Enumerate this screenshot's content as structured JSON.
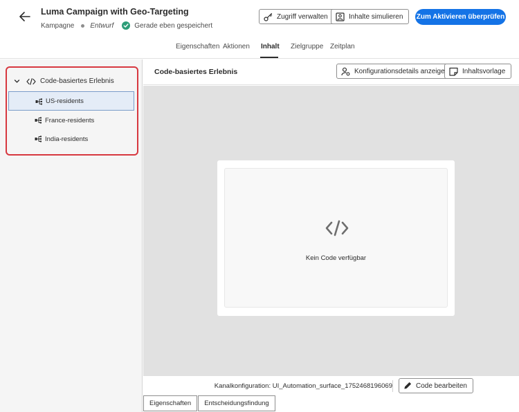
{
  "header": {
    "title": "Luma Campaign with Geo-Targeting",
    "type": "Kampagne",
    "status": "Entwurf",
    "save_status": "Gerade eben gespeichert",
    "manage_access": "Zugriff verwalten",
    "simulate_content": "Inhalte simulieren",
    "review_activate": "Zum Aktivieren überprüfen"
  },
  "tabs": [
    "Eigenschaften",
    "Aktionen",
    "Inhalt",
    "Zielgruppe",
    "Zeitplan"
  ],
  "active_tab": "Inhalt",
  "tree": {
    "root": "Code-basiertes Erlebnis",
    "items": [
      "US-residents",
      "France-residents",
      "India-residents"
    ],
    "selected": "US-residents"
  },
  "content": {
    "title": "Code-basiertes Erlebnis",
    "config_details": "Konfigurationsdetails anzeigen",
    "content_template": "Inhaltsvorlage",
    "empty_message": "Kein Code verfügbar"
  },
  "footer": {
    "channel_config": "Kanalkonfiguration: UI_Automation_surface_1752468196069",
    "edit_code": "Code bearbeiten"
  },
  "bottom_tabs": [
    "Eigenschaften",
    "Entscheidungsfindung"
  ],
  "colors": {
    "accent": "#1473e6",
    "highlight_border": "#d7373f",
    "success": "#2d9d78"
  }
}
